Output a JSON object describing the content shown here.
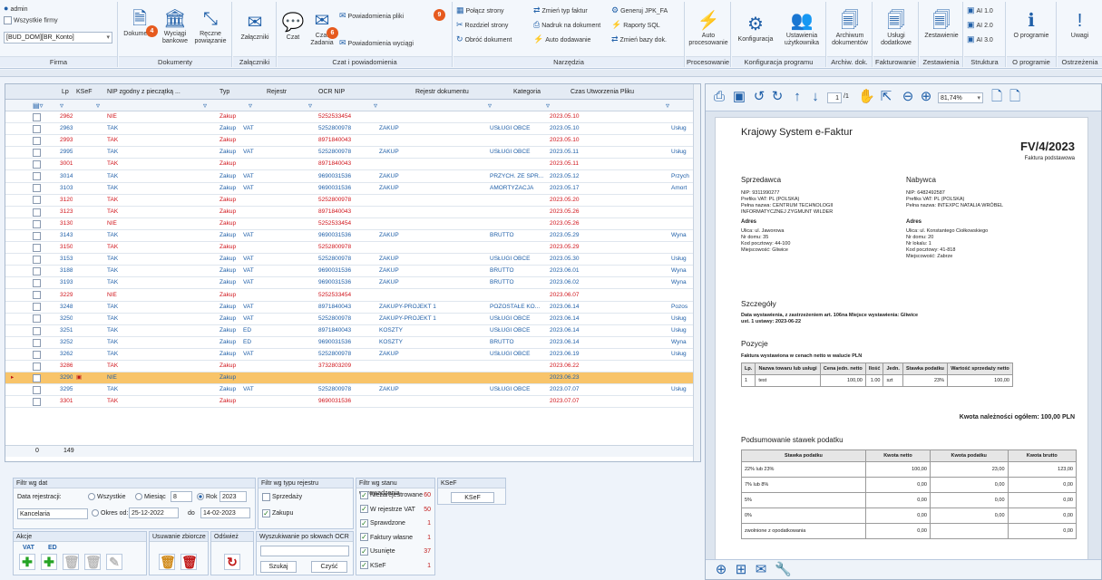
{
  "ribbon": {
    "user": "admin",
    "all_companies": "Wszystkie firmy",
    "company_select": "[BUD_DOM][BR_Konto]",
    "groups": [
      {
        "caption": "Firma"
      },
      {
        "caption": "Dokumenty"
      },
      {
        "caption": "Załączniki"
      },
      {
        "caption": "Czat i powiadomienia"
      },
      {
        "caption": "Narzędzia"
      },
      {
        "caption": "Procesowanie"
      },
      {
        "caption": "Konfiguracja programu"
      },
      {
        "caption": "Archiw. dok."
      },
      {
        "caption": "Fakturowanie"
      },
      {
        "caption": "Zestawienia"
      },
      {
        "caption": "Struktura OCR"
      },
      {
        "caption": "O programie"
      },
      {
        "caption": "Ostrzeżenia"
      }
    ],
    "buttons": {
      "dokumenty": "Dokumenty",
      "dokumenty_badge": "4",
      "wyciagi": "Wyciągi bankowe",
      "reczne": "Ręczne powiązanie",
      "zalaczniki": "Załączniki",
      "czat": "Czat",
      "czat_zadania": "Czat Zadania",
      "czat_badge": "6",
      "powiad_pliki": "Powiadomienia pliki",
      "powiad_pliki_badge": "9",
      "powiad_wyciagi": "Powiadomienia wyciągi",
      "polacz": "Połącz strony",
      "rozdziel": "Rozdziel strony",
      "obroc": "Obróć dokument",
      "zmien_typ": "Zmień typ faktur",
      "nadruk": "Nadruk na dokument",
      "autododawanie": "Auto dodawanie",
      "generuj": "Generuj JPK_FA",
      "raporty": "Raporty SQL",
      "zmien_bazy": "Zmień bazy dok.",
      "auto_proc": "Auto procesowanie",
      "konfiguracja": "Konfiguracja",
      "ustawienia": "Ustawienia użytkownika",
      "archiwum": "Archiwum dokumentów",
      "uslugi": "Usługi dodatkowe",
      "zestawienie": "Zestawienie",
      "ai1": "AI 1.0",
      "ai2": "AI 2.0",
      "ai3": "AI 3.0",
      "oprogramie": "O programie",
      "uwagi": "Uwagi"
    }
  },
  "grid": {
    "headers": [
      "Lp",
      "KSeF",
      "NIP zgodny z pieczątką ...",
      "Typ",
      "Rejestr",
      "OCR NIP",
      "Rejestr dokumentu",
      "Kategoria",
      "Czas Utworzenia Pliku"
    ],
    "rows": [
      {
        "lp": "2962",
        "nip_ok": "NIE",
        "typ": "Zakup",
        "rej": "",
        "ocr": "5252533454",
        "rejdok": "",
        "kat": "",
        "czas": "2023.05.10",
        "extra": "",
        "red": true
      },
      {
        "lp": "2963",
        "nip_ok": "TAK",
        "typ": "Zakup",
        "rej": "VAT",
        "ocr": "5252800978",
        "rejdok": "ZAKUP",
        "kat": "USŁUGI OBCE",
        "czas": "2023.05.10",
        "extra": "Usług",
        "red": false
      },
      {
        "lp": "2993",
        "nip_ok": "TAK",
        "typ": "Zakup",
        "rej": "",
        "ocr": "8971840043",
        "rejdok": "",
        "kat": "",
        "czas": "2023.05.10",
        "extra": "",
        "red": true
      },
      {
        "lp": "2995",
        "nip_ok": "TAK",
        "typ": "Zakup",
        "rej": "VAT",
        "ocr": "5252800978",
        "rejdok": "ZAKUP",
        "kat": "USŁUGI OBCE",
        "czas": "2023.05.11",
        "extra": "Usług",
        "red": false
      },
      {
        "lp": "3001",
        "nip_ok": "TAK",
        "typ": "Zakup",
        "rej": "",
        "ocr": "8971840043",
        "rejdok": "",
        "kat": "",
        "czas": "2023.05.11",
        "extra": "",
        "red": true
      },
      {
        "lp": "3014",
        "nip_ok": "TAK",
        "typ": "Zakup",
        "rej": "VAT",
        "ocr": "9690031536",
        "rejdok": "ZAKUP",
        "kat": "PRZYCH. ZE SPR...",
        "czas": "2023.05.12",
        "extra": "Przych",
        "red": false
      },
      {
        "lp": "3103",
        "nip_ok": "TAK",
        "typ": "Zakup",
        "rej": "VAT",
        "ocr": "9690031536",
        "rejdok": "ZAKUP",
        "kat": "AMORTYZACJA",
        "czas": "2023.05.17",
        "extra": "Amort",
        "red": false
      },
      {
        "lp": "3120",
        "nip_ok": "TAK",
        "typ": "Zakup",
        "rej": "",
        "ocr": "5252800978",
        "rejdok": "",
        "kat": "",
        "czas": "2023.05.20",
        "extra": "",
        "red": true
      },
      {
        "lp": "3123",
        "nip_ok": "TAK",
        "typ": "Zakup",
        "rej": "",
        "ocr": "8971840043",
        "rejdok": "",
        "kat": "",
        "czas": "2023.05.26",
        "extra": "",
        "red": true
      },
      {
        "lp": "3130",
        "nip_ok": "NIE",
        "typ": "Zakup",
        "rej": "",
        "ocr": "5252533454",
        "rejdok": "",
        "kat": "",
        "czas": "2023.05.26",
        "extra": "",
        "red": true
      },
      {
        "lp": "3143",
        "nip_ok": "TAK",
        "typ": "Zakup",
        "rej": "VAT",
        "ocr": "9690031536",
        "rejdok": "ZAKUP",
        "kat": "BRUTTO",
        "czas": "2023.05.29",
        "extra": "Wyna",
        "red": false
      },
      {
        "lp": "3150",
        "nip_ok": "TAK",
        "typ": "Zakup",
        "rej": "",
        "ocr": "5252800978",
        "rejdok": "",
        "kat": "",
        "czas": "2023.05.29",
        "extra": "",
        "red": true
      },
      {
        "lp": "3153",
        "nip_ok": "TAK",
        "typ": "Zakup",
        "rej": "VAT",
        "ocr": "5252800978",
        "rejdok": "ZAKUP",
        "kat": "USŁUGI OBCE",
        "czas": "2023.05.30",
        "extra": "Usług",
        "red": false
      },
      {
        "lp": "3188",
        "nip_ok": "TAK",
        "typ": "Zakup",
        "rej": "VAT",
        "ocr": "9690031536",
        "rejdok": "ZAKUP",
        "kat": "BRUTTO",
        "czas": "2023.06.01",
        "extra": "Wyna",
        "red": false
      },
      {
        "lp": "3193",
        "nip_ok": "TAK",
        "typ": "Zakup",
        "rej": "VAT",
        "ocr": "9690031536",
        "rejdok": "ZAKUP",
        "kat": "BRUTTO",
        "czas": "2023.06.02",
        "extra": "Wyna",
        "red": false
      },
      {
        "lp": "3229",
        "nip_ok": "NIE",
        "typ": "Zakup",
        "rej": "",
        "ocr": "5252533454",
        "rejdok": "",
        "kat": "",
        "czas": "2023.06.07",
        "extra": "",
        "red": true
      },
      {
        "lp": "3248",
        "nip_ok": "TAK",
        "typ": "Zakup",
        "rej": "VAT",
        "ocr": "8971840043",
        "rejdok": "ZAKUPY-PROJEKT 1",
        "kat": "POZOSTAŁE KO...",
        "czas": "2023.06.14",
        "extra": "Pozos",
        "red": false
      },
      {
        "lp": "3250",
        "nip_ok": "TAK",
        "typ": "Zakup",
        "rej": "VAT",
        "ocr": "5252800978",
        "rejdok": "ZAKUPY-PROJEKT 1",
        "kat": "USŁUGI OBCE",
        "czas": "2023.06.14",
        "extra": "Usług",
        "red": false
      },
      {
        "lp": "3251",
        "nip_ok": "TAK",
        "typ": "Zakup",
        "rej": "ED",
        "ocr": "8971840043",
        "rejdok": "KOSZTY",
        "kat": "USŁUGI OBCE",
        "czas": "2023.06.14",
        "extra": "Usług",
        "red": false
      },
      {
        "lp": "3252",
        "nip_ok": "TAK",
        "typ": "Zakup",
        "rej": "ED",
        "ocr": "9690031536",
        "rejdok": "KOSZTY",
        "kat": "BRUTTO",
        "czas": "2023.06.14",
        "extra": "Wyna",
        "red": false
      },
      {
        "lp": "3262",
        "nip_ok": "TAK",
        "typ": "Zakup",
        "rej": "VAT",
        "ocr": "5252800978",
        "rejdok": "ZAKUP",
        "kat": "USŁUGI OBCE",
        "czas": "2023.06.19",
        "extra": "Usług",
        "red": false
      },
      {
        "lp": "3286",
        "nip_ok": "TAK",
        "typ": "Zakup",
        "rej": "",
        "ocr": "3732803209",
        "rejdok": "",
        "kat": "",
        "czas": "2023.06.22",
        "extra": "",
        "red": true
      },
      {
        "lp": "3290",
        "nip_ok": "NIE",
        "typ": "Zakup",
        "rej": "",
        "ocr": "",
        "rejdok": "",
        "kat": "",
        "czas": "2023.06.23",
        "extra": "",
        "red": false,
        "selected": true
      },
      {
        "lp": "3295",
        "nip_ok": "TAK",
        "typ": "Zakup",
        "rej": "VAT",
        "ocr": "5252800978",
        "rejdok": "ZAKUP",
        "kat": "USŁUGI OBCE",
        "czas": "2023.07.07",
        "extra": "Usług",
        "red": false
      },
      {
        "lp": "3301",
        "nip_ok": "TAK",
        "typ": "Zakup",
        "rej": "",
        "ocr": "9690031536",
        "rejdok": "",
        "kat": "",
        "czas": "2023.07.07",
        "extra": "",
        "red": true
      }
    ],
    "footer_zero": "0",
    "footer_count": "149"
  },
  "filters": {
    "data_title": "Filtr wg dat",
    "data_rejestracji": "Data rejestracji:",
    "wszystkie": "Wszystkie",
    "miesiac": "Miesiąc",
    "miesiac_val": "8",
    "rok": "Rok",
    "rok_val": "2023",
    "okres_od": "Okres od:",
    "okres_od_val": "25-12-2022",
    "do": "do",
    "do_val": "14-02-2023",
    "kancelaria": "Kancelaria",
    "typ_title": "Filtr wg typu rejestru",
    "sprzedazy": "Sprzedaży",
    "zakupu": "Zakupu",
    "stan_title": "Filtr wg stanu wprowadzenia",
    "stan": [
      {
        "label": "Niezarejestrowane",
        "count": "60"
      },
      {
        "label": "W rejestrze VAT",
        "count": "50"
      },
      {
        "label": "Sprawdzone",
        "count": "1"
      },
      {
        "label": "Faktury własne",
        "count": "1"
      },
      {
        "label": "Usunięte",
        "count": "37"
      },
      {
        "label": "KSeF",
        "count": "1"
      }
    ],
    "ksef_title": "KSeF",
    "ksef_button": "KSeF",
    "akcje_title": "Akcje",
    "vat": "VAT",
    "ed": "ED",
    "usuwanie_title": "Usuwanie zbiorcze",
    "odswiez_title": "Odśwież",
    "wyszukiwanie_title": "Wyszukiwanie po słowach OCR",
    "szukaj": "Szukaj",
    "czysc": "Czyść"
  },
  "preview": {
    "page": "1",
    "pages": "/1",
    "zoom": "81,74%",
    "doc": {
      "system": "Krajowy System e-Faktur",
      "number": "FV/4/2023",
      "kind": "Faktura podstawowa",
      "seller_h": "Sprzedawca",
      "buyer_h": "Nabywca",
      "seller": [
        "NIP: 9311990277",
        "Prefiks VAT: PL (POLSKA)",
        "Pełna nazwa: CENTRUM TECHNOLOGII",
        "INFORMATYCZNEJ ZYGMUNT WILDER"
      ],
      "buyer": [
        "NIP: 6482492587",
        "Prefiks VAT: PL (POLSKA)",
        "Pełna nazwa: INTEXPC NATALIA WRÓBEL"
      ],
      "adres_h": "Adres",
      "seller_addr": [
        "Ulica: ul. Jaworowa",
        "Nr domu: 35",
        "Kod pocztowy: 44-100",
        "Miejscowość: Gliwice"
      ],
      "buyer_addr": [
        "Ulica: ul. Konstantego Ciołkowskiego",
        "Nr domu: 20",
        "Nr lokalu: 1",
        "Kod pocztowy: 41-818",
        "Miejscowość: Zabrze"
      ],
      "szczegoly_h": "Szczegóły",
      "szczegoly1": "Data wystawienia, z zastrzeżeniem art. 106na   Miejsce wystawienia: Gliwice",
      "szczegoly2": "ust. 1 ustawy: 2023-06-22",
      "pozycje_h": "Pozycje",
      "pozycje_sub": "Faktura wystawiona w cenach netto w walucie PLN",
      "items_head": [
        "Lp.",
        "Nazwa towaru lub usługi",
        "Cena jedn. netto",
        "Ilość",
        "Jedn.",
        "Stawka podatku",
        "Wartość sprzedaży netto"
      ],
      "items": [
        [
          "1",
          "test",
          "100,00",
          "1.00",
          "szt",
          "23%",
          "100,00"
        ]
      ],
      "kwota": "Kwota należności ogółem: 100,00 PLN",
      "podsum_h": "Podsumowanie stawek podatku",
      "podsum_head": [
        "Stawka podatku",
        "Kwota netto",
        "Kwota podatku",
        "Kwota brutto"
      ],
      "podsum": [
        [
          "22% lub 23%",
          "100,00",
          "23,00",
          "123,00"
        ],
        [
          "7% lub 8%",
          "0,00",
          "0,00",
          "0,00"
        ],
        [
          "5%",
          "0,00",
          "0,00",
          "0,00"
        ],
        [
          "0%",
          "0,00",
          "0,00",
          "0,00"
        ],
        [
          "zwolnione z opodatkowania",
          "0,00",
          "",
          "0,00"
        ]
      ]
    }
  }
}
